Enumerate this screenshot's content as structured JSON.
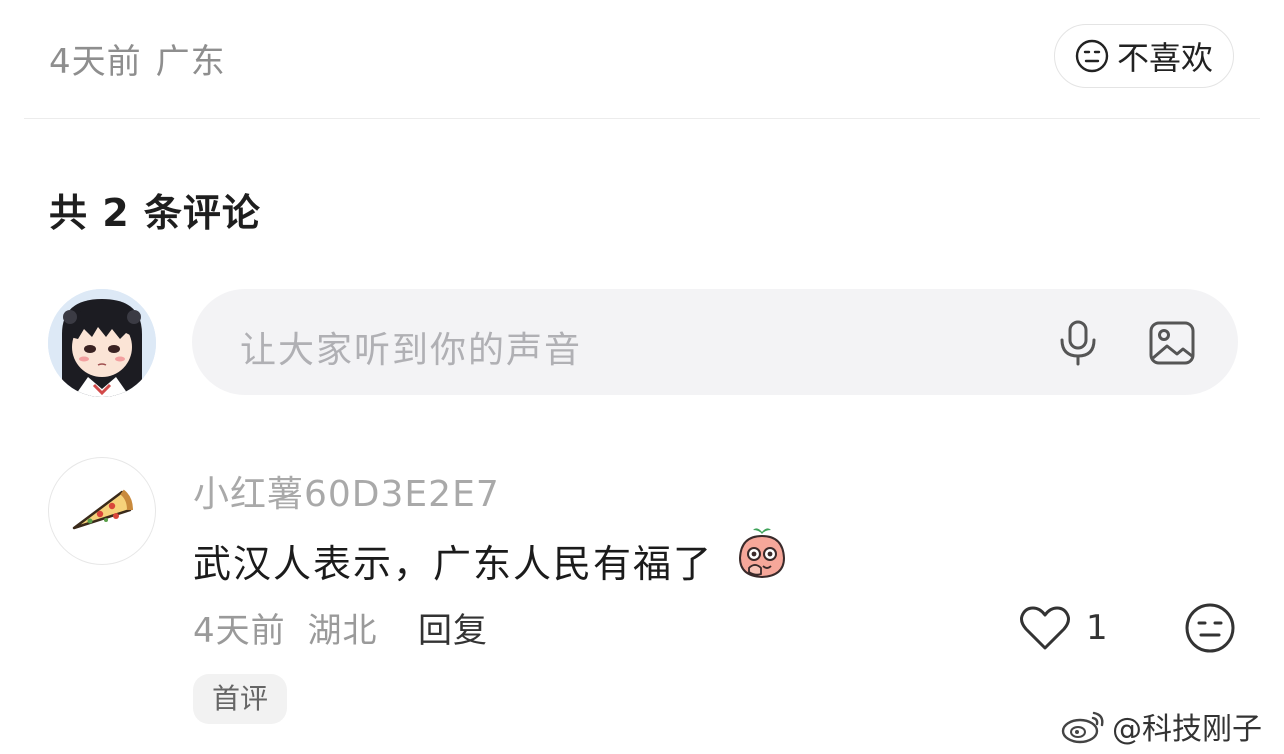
{
  "post_meta": {
    "time": "4天前",
    "location": "广东"
  },
  "dislike_button": {
    "label": "不喜欢",
    "icon": "neutral-face-icon"
  },
  "comments_header": {
    "label": "共 2 条评论"
  },
  "comment_input": {
    "placeholder": "让大家听到你的声音",
    "icons": [
      "microphone-icon",
      "image-icon"
    ]
  },
  "comments": [
    {
      "username": "小红薯60D3E2E7",
      "text": "武汉人表示，广东人民有福了",
      "emoji": "peach-face-emoji",
      "time": "4天前",
      "location": "湖北",
      "reply_label": "回复",
      "like_count": "1",
      "badge": "首评"
    }
  ],
  "watermark": {
    "text": "@科技刚子",
    "icon": "weibo-logo"
  },
  "colors": {
    "input_bg": "#f3f3f5",
    "muted_text": "#9a9a9a",
    "badge_bg": "#f2f2f2",
    "divider": "#ececec"
  }
}
